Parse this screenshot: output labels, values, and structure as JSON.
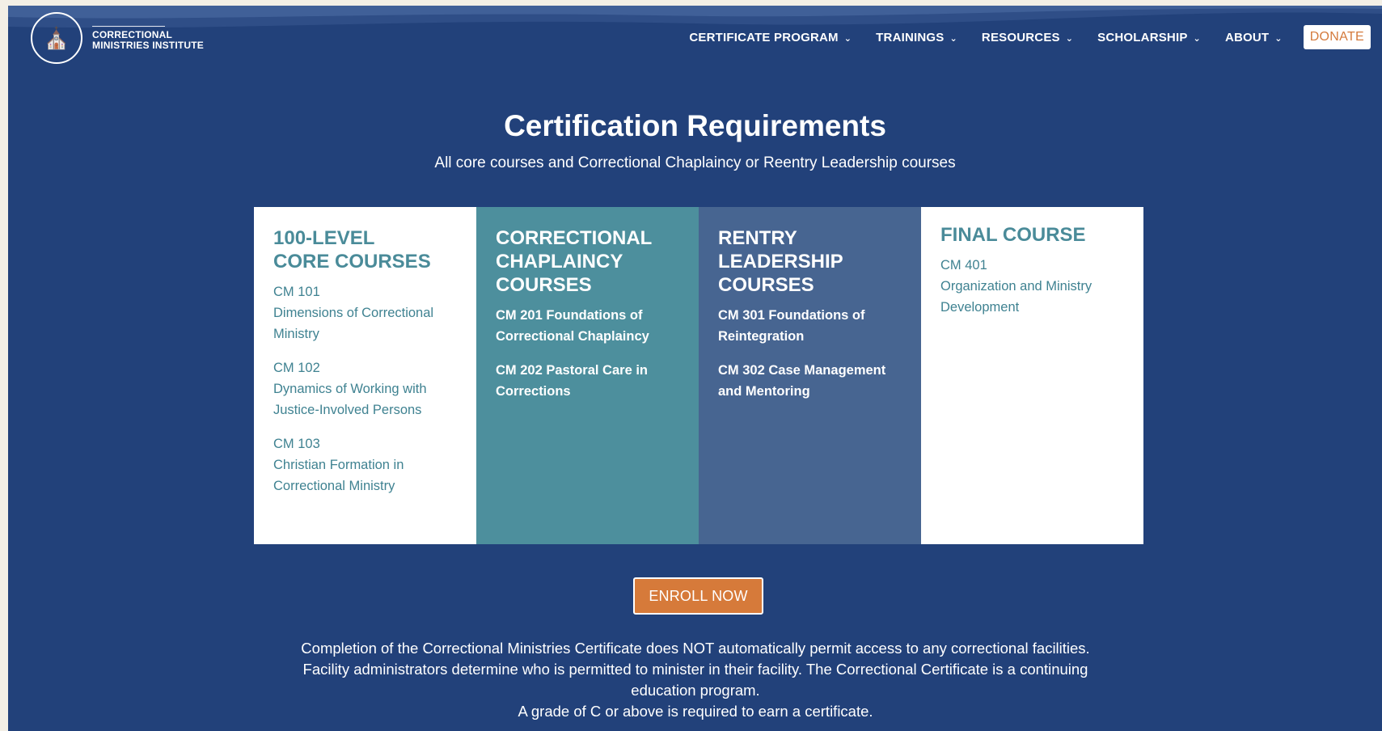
{
  "header": {
    "logo_line1": "CORRECTIONAL",
    "logo_line2": "MINISTRIES INSTITUTE",
    "nav": [
      {
        "label": "CERTIFICATE PROGRAM"
      },
      {
        "label": "TRAININGS"
      },
      {
        "label": "RESOURCES"
      },
      {
        "label": "SCHOLARSHIP"
      },
      {
        "label": "ABOUT"
      }
    ],
    "donate_label": "DONATE"
  },
  "main": {
    "title": "Certification Requirements",
    "subtitle": "All core courses and Correctional Chaplaincy or Reentry Leadership courses",
    "cards": [
      {
        "title": "100-LEVEL\nCORE COURSES",
        "courses": [
          {
            "code": "CM 101",
            "name": "Dimensions of Correctional Ministry"
          },
          {
            "code": "CM 102",
            "name": "Dynamics of Working with Justice-Involved Persons"
          },
          {
            "code": "CM 103",
            "name": "Christian Formation in Correctional Ministry"
          }
        ]
      },
      {
        "title": "CORRECTIONAL\nCHAPLAINCY\nCOURSES",
        "courses": [
          {
            "text": "CM 201 Foundations of Correctional Chaplaincy"
          },
          {
            "text": "CM 202 Pastoral Care in Corrections"
          }
        ]
      },
      {
        "title": "RENTRY\nLEADERSHIP\nCOURSES",
        "courses": [
          {
            "text": "CM 301 Foundations of Reintegration"
          },
          {
            "text": "CM 302 Case Management and Mentoring"
          }
        ]
      },
      {
        "title": "FINAL COURSE",
        "courses": [
          {
            "code": "CM 401",
            "name": "Organization and Ministry Development"
          }
        ]
      }
    ],
    "enroll_label": "ENROLL NOW",
    "note_line1": "Completion of the Correctional Ministries Certificate does NOT automatically permit access to any correctional facilities. Facility administrators determine who is permitted to minister in their facility. The Correctional Certificate is a continuing education program.",
    "note_line2": "A grade of C or above is required to earn a certificate."
  },
  "colors": {
    "page_bg": "#22417a",
    "teal_card": "#4d8f9d",
    "slate_card": "#476591",
    "accent_orange": "#d67a3a"
  },
  "icons": {
    "logo": "college-seal-icon",
    "dropdown": "chevron-down-icon"
  }
}
